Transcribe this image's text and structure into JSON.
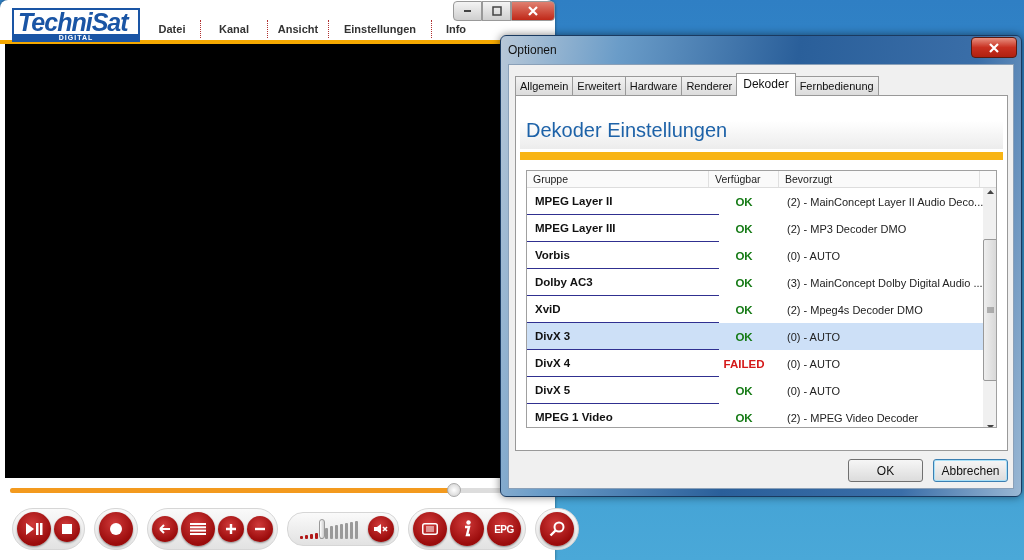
{
  "player": {
    "logo": {
      "name": "TechniSat",
      "subtitle": "DIGITAL"
    },
    "menu": [
      {
        "label": "Datei"
      },
      {
        "label": "Kanal"
      },
      {
        "label": "Ansicht"
      },
      {
        "label": "Einstellungen"
      },
      {
        "label": "Info"
      }
    ],
    "seek": {
      "level": 0.83
    },
    "volume": {
      "level": 0.35
    },
    "epg_label": "EPG"
  },
  "dialog": {
    "title": "Optionen",
    "tabs": [
      {
        "label": "Allgemein",
        "selected": false
      },
      {
        "label": "Erweitert",
        "selected": false
      },
      {
        "label": "Hardware",
        "selected": false
      },
      {
        "label": "Renderer",
        "selected": false
      },
      {
        "label": "Dekoder",
        "selected": true
      },
      {
        "label": "Fernbedienung",
        "selected": false
      }
    ],
    "heading": "Dekoder Einstellungen",
    "table": {
      "columns": [
        "Gruppe",
        "Verfügbar",
        "Bevorzugt"
      ],
      "rows": [
        {
          "group": "MPEG Layer II",
          "status": "OK",
          "available": true,
          "preferred": "(2) - MainConcept Layer II Audio Deco...",
          "selected": false
        },
        {
          "group": "MPEG Layer III",
          "status": "OK",
          "available": true,
          "preferred": "(2) - MP3 Decoder DMO",
          "selected": false
        },
        {
          "group": "Vorbis",
          "status": "OK",
          "available": true,
          "preferred": "(0) - AUTO",
          "selected": false
        },
        {
          "group": "Dolby AC3",
          "status": "OK",
          "available": true,
          "preferred": "(3) - MainConcept Dolby Digital Audio ...",
          "selected": false
        },
        {
          "group": "XviD",
          "status": "OK",
          "available": true,
          "preferred": "(2) - Mpeg4s Decoder DMO",
          "selected": false
        },
        {
          "group": "DivX 3",
          "status": "OK",
          "available": true,
          "preferred": "(0) - AUTO",
          "selected": true
        },
        {
          "group": "DivX 4",
          "status": "FAILED",
          "available": false,
          "preferred": "(0) - AUTO",
          "selected": false
        },
        {
          "group": "DivX 5",
          "status": "OK",
          "available": true,
          "preferred": "(0) - AUTO",
          "selected": false
        },
        {
          "group": "MPEG 1 Video",
          "status": "OK",
          "available": true,
          "preferred": "(2) - MPEG Video Decoder",
          "selected": false
        }
      ]
    },
    "buttons": [
      {
        "label": "OK",
        "focused": false
      },
      {
        "label": "Abbrechen",
        "focused": true
      }
    ]
  }
}
